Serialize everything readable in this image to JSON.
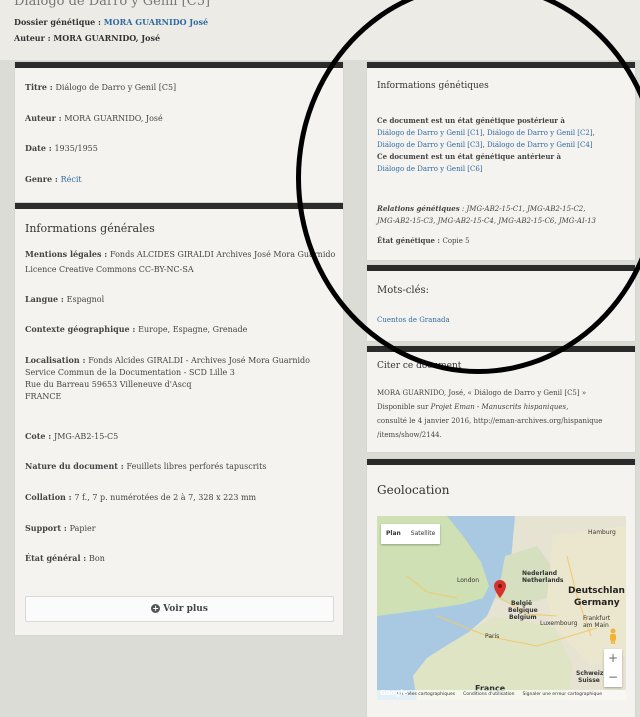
{
  "header": {
    "doc_title": "Dialogo de Darro y Genil [C5]",
    "dossier_label": "Dossier génétique : ",
    "dossier_value": "MORA GUARNIDO José",
    "auteur_label": "Auteur : ",
    "auteur_value": "MORA GUARNIDO, José"
  },
  "summary_card": {
    "titre_label": "Titre : ",
    "titre_value": "Diálogo de Darro y Genil [C5]",
    "auteur_label": "Auteur : ",
    "auteur_value": "MORA GUARNIDO, José",
    "date_label": "Date : ",
    "date_value": "1935/1955",
    "genre_label": "Genre : ",
    "genre_value": "Récit"
  },
  "general_info": {
    "heading": "Informations générales",
    "mentions_label": "Mentions légales : ",
    "mentions_value": "Fonds ALCIDES GIRALDI Archives José Mora Guarnido",
    "licence": "Licence Creative Commons CC-BY-NC-SA",
    "langue_label": "Langue : ",
    "langue_value": "Espagnol",
    "contexte_label": "Contexte géographique : ",
    "contexte_value": "Europe, Espagne, Grenade",
    "localisation_label": "Localisation : ",
    "localisation_lines": [
      "Fonds Alcides GIRALDI - Archives José Mora Guarnido",
      "Service Commun de la Documentation - SCD Lille 3",
      "Rue du Barreau 59653 Villeneuve d'Ascq",
      "FRANCE"
    ],
    "cote_label": "Cote : ",
    "cote_value": "JMG-AB2-15-C5",
    "nature_label": "Nature du document : ",
    "nature_value": "Feuillets libres perforés tapuscrits",
    "collation_label": "Collation : ",
    "collation_value": "7 f., 7 p. numérotées de 2 à 7, 328 x 223 mm",
    "support_label": "Support : ",
    "support_value": "Papier",
    "etat_label": "État général : ",
    "etat_value": "Bon",
    "voir_plus": "Voir plus"
  },
  "genetic_info": {
    "heading": "Informations génétiques",
    "posterior_text": "Ce document est un état génétique postérieur à",
    "posterior_links": [
      "Diálogo de Darro y Genil [C1]",
      "Diálogo de Darro y Genil [C2]",
      "Diálogo de Darro y Genil [C3]",
      "Diálogo de Darro y Genil [C4]"
    ],
    "anterior_text": "Ce document est un état génétique antérieur à",
    "anterior_links": [
      "Diálogo de Darro y Genil [C6]"
    ],
    "relations_label": "Relations génétiques",
    "relations_line1": " : JMG-AB2-15-C1, JMG-AB2-15-C2,",
    "relations_line2": "JMG-AB2-15-C3, JMG-AB2-15-C4, JMG-AB2-15-C6, JMG-AI-13",
    "etat_label": "État génétique : ",
    "etat_value": "Copie 5"
  },
  "keywords": {
    "heading": "Mots-clés:",
    "items": [
      "Cuentos de Granada"
    ]
  },
  "citation": {
    "heading": "Citer ce document",
    "line1": "MORA GUARNIDO, José, « Diálogo de Darro y Genil [C5] »",
    "line2_prefix": "Disponible sur ",
    "line2_italic": "Projet Eman - Manuscrits hispaniques",
    "line2_suffix": ",",
    "line3": "consulté le 4 janvier 2016, http://eman-archives.org/hispanique",
    "line4": "/items/show/2144."
  },
  "geolocation": {
    "heading": "Geolocation",
    "map_type_plan": "Plan",
    "map_type_satellite": "Satellite",
    "labels": {
      "hamburg": "Hamburg",
      "nederland": "Nederland",
      "netherlands": "Netherlands",
      "london": "London",
      "deutschland": "Deutschlan",
      "germany": "Germany",
      "belgie": "België",
      "belgique": "Belgique",
      "belgium": "Belgium",
      "luxembourg": "Luxembourg",
      "frankfurt": "Frankfurt",
      "am_main": "am Main",
      "paris": "Paris",
      "schweiz": "Schweiz",
      "suisse": "Suisse",
      "france": "France"
    },
    "google": "Google",
    "attribution": [
      "Données cartographiques",
      "Conditions d'utilisation",
      "Signaler une erreur cartographique"
    ],
    "zoom_in": "+",
    "zoom_out": "−"
  },
  "colors": {
    "link": "#2f6aa2",
    "card_top_border": "#2b2b2b",
    "card_bg": "#f4f3ef",
    "page_bg": "#dcdcd6",
    "marker": "#d6322b",
    "annotation_circle": "#000000"
  }
}
